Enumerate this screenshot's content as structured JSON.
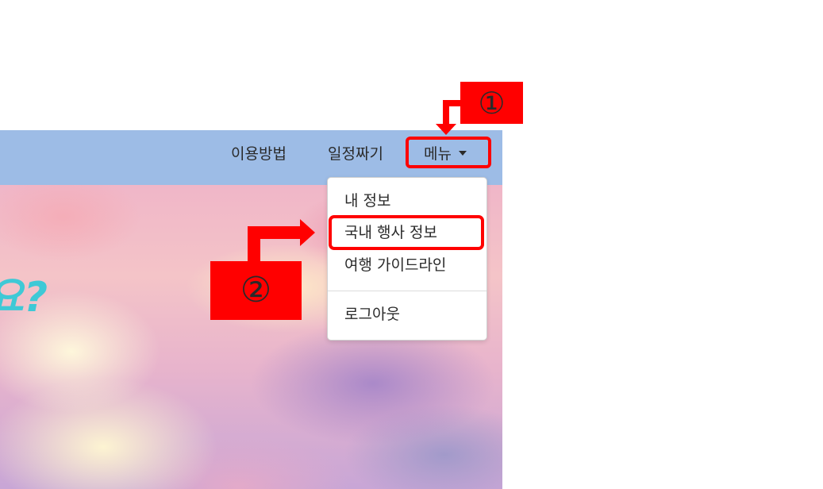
{
  "navbar": {
    "links": [
      {
        "label": "이용방법"
      },
      {
        "label": "일정짜기"
      },
      {
        "label": "메뉴"
      }
    ]
  },
  "hero": {
    "title_fragment": "요?"
  },
  "dropdown": {
    "items": [
      {
        "label": "내 정보"
      },
      {
        "label": "국내 행사 정보"
      },
      {
        "label": "여행 가이드라인"
      },
      {
        "label": "로그아웃"
      }
    ]
  },
  "annotations": {
    "step1": "①",
    "step2": "②",
    "color": "#ff0000"
  },
  "colors": {
    "navbar": "#9dbce6",
    "hero_title": "#3ec9d6"
  }
}
